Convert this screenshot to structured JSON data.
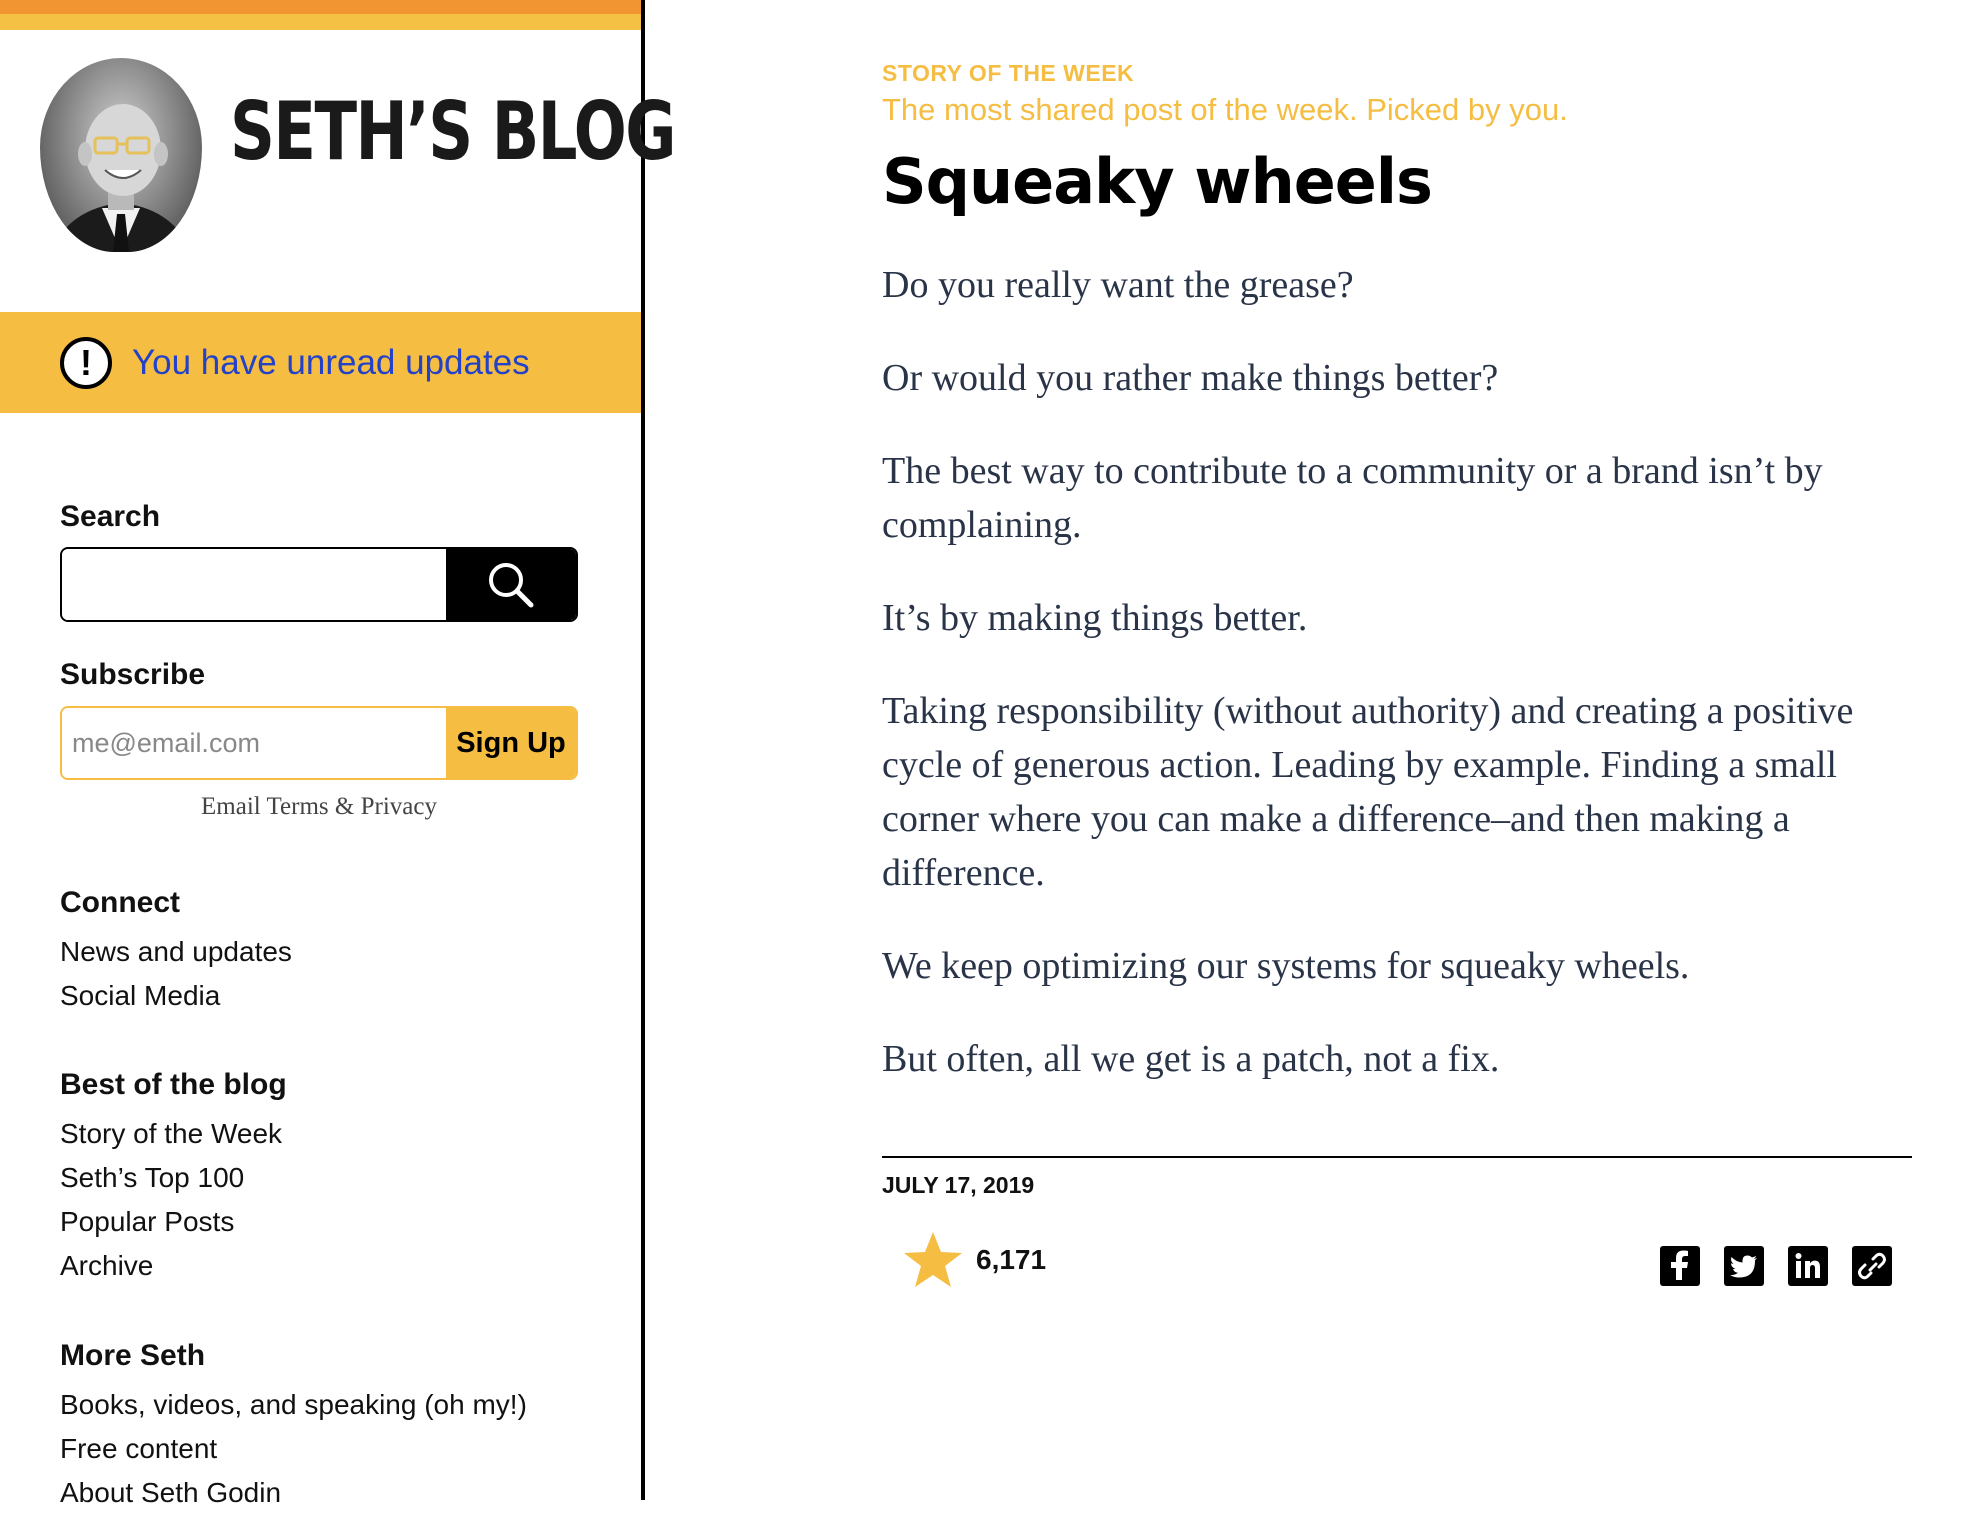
{
  "sidebar": {
    "site_title": "SETH’S BLOG",
    "alert_text": "You have unread updates",
    "search": {
      "heading": "Search",
      "value": ""
    },
    "subscribe": {
      "heading": "Subscribe",
      "placeholder": "me@email.com",
      "button_label": "Sign Up",
      "terms": "Email Terms & Privacy"
    },
    "connect": {
      "heading": "Connect",
      "items": [
        "News and updates",
        "Social Media"
      ]
    },
    "best": {
      "heading": "Best of the blog",
      "items": [
        "Story of the Week",
        "Seth’s Top 100",
        "Popular Posts",
        "Archive"
      ]
    },
    "more": {
      "heading": "More Seth",
      "items": [
        "Books, videos, and speaking (oh my!)",
        "Free content",
        "About Seth Godin"
      ]
    }
  },
  "main": {
    "kicker": "STORY OF THE WEEK",
    "kicker_sub": "The most shared post of the week. Picked by you.",
    "title": "Squeaky wheels",
    "paragraphs": [
      "Do you really want the grease?",
      "Or would you rather make things better?",
      "The best way to contribute to a community or a brand isn’t by complaining.",
      "It’s by making things better.",
      "Taking responsibility (without authority) and creating a positive cycle of generous action. Leading by example. Finding a small corner where you can make a difference–and then making a difference.",
      "We keep optimizing our systems for squeaky wheels.",
      "But often, all we get is a patch, not a fix."
    ],
    "date": "JULY 17, 2019",
    "star_count": "6,171",
    "share_icons": [
      "facebook-icon",
      "twitter-icon",
      "linkedin-icon",
      "link-icon"
    ]
  },
  "colors": {
    "accent_yellow": "#f5bd42",
    "accent_orange": "#f19533",
    "link_blue": "#2342c8",
    "body_text": "#2a3448"
  }
}
